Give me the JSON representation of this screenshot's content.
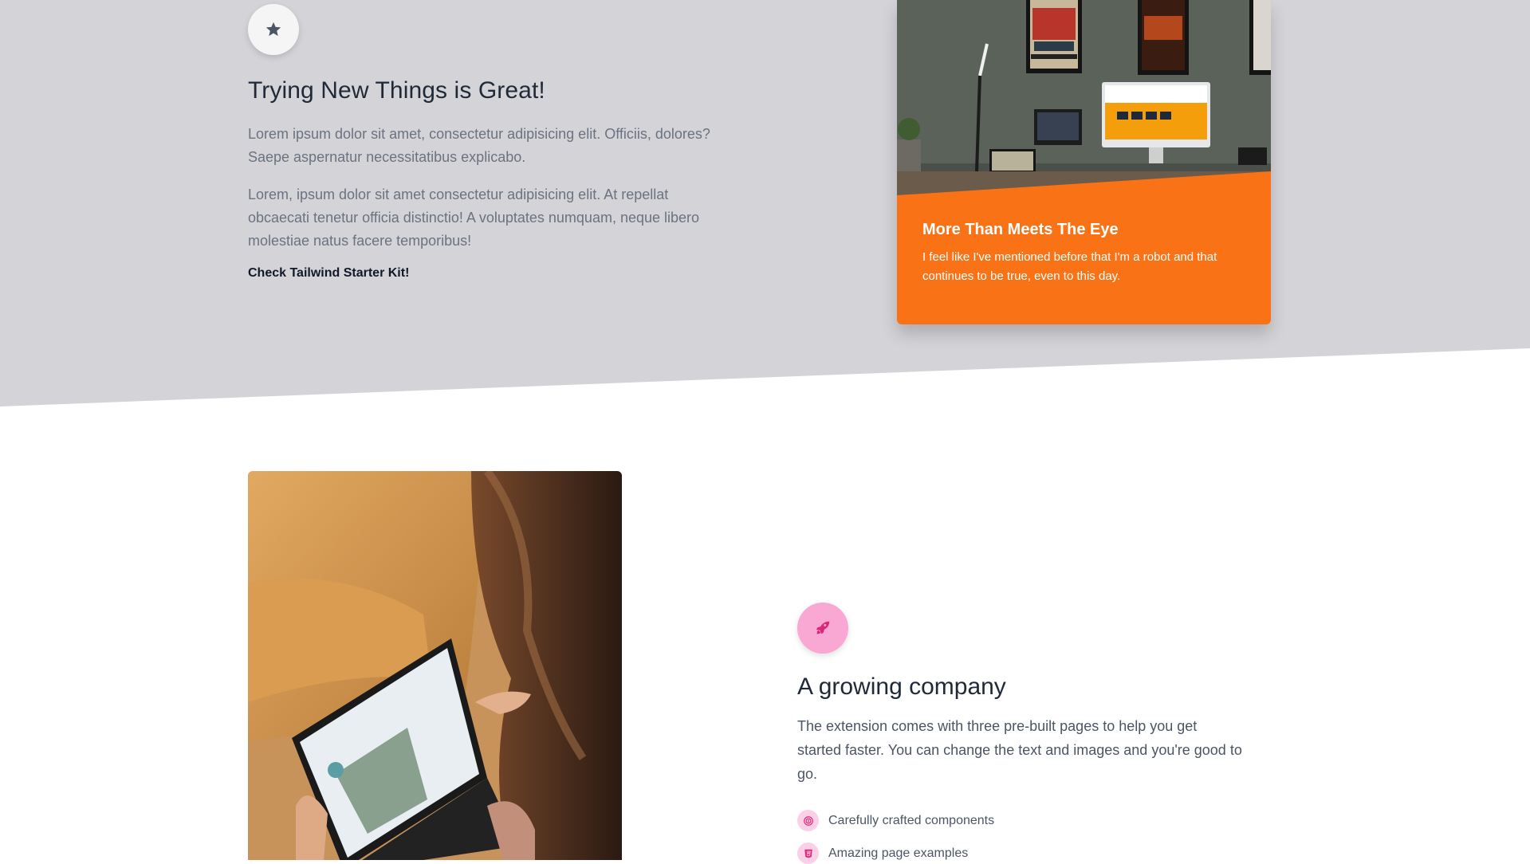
{
  "colors": {
    "grey_band": "#d4d4d8",
    "orange_card": "#f97316",
    "pink_icon_bg": "#f9a8d4",
    "pink_icon": "#db2777"
  },
  "intro": {
    "icon": "star-icon",
    "title": "Trying New Things is Great!",
    "paragraph_1": "Lorem ipsum dolor sit amet, consectetur adipisicing elit. Officiis, dolores? Saepe aspernatur necessitatibus explicabo.",
    "paragraph_2": "Lorem, ipsum dolor sit amet consectetur adipisicing elit. At repellat obcaecati tenetur officia distinctio! A voluptates numquam, neque libero molestiae natus facere temporibus!",
    "link": "Check Tailwind Starter Kit!"
  },
  "card": {
    "image": "desk-setup-photo",
    "title": "More Than Meets The Eye",
    "text": "I feel like I've mentioned before that I'm a robot and that continues to be true, even to this day."
  },
  "company": {
    "image": "woman-with-tablet-photo",
    "icon": "rocket-icon",
    "title": "A growing company",
    "paragraph": "The extension comes with three pre-built pages to help you get started faster. You can change the text and images and you're good to go.",
    "features": [
      {
        "icon": "fingerprint-icon",
        "label": "Carefully crafted components"
      },
      {
        "icon": "html5-icon",
        "label": "Amazing page examples"
      }
    ]
  }
}
